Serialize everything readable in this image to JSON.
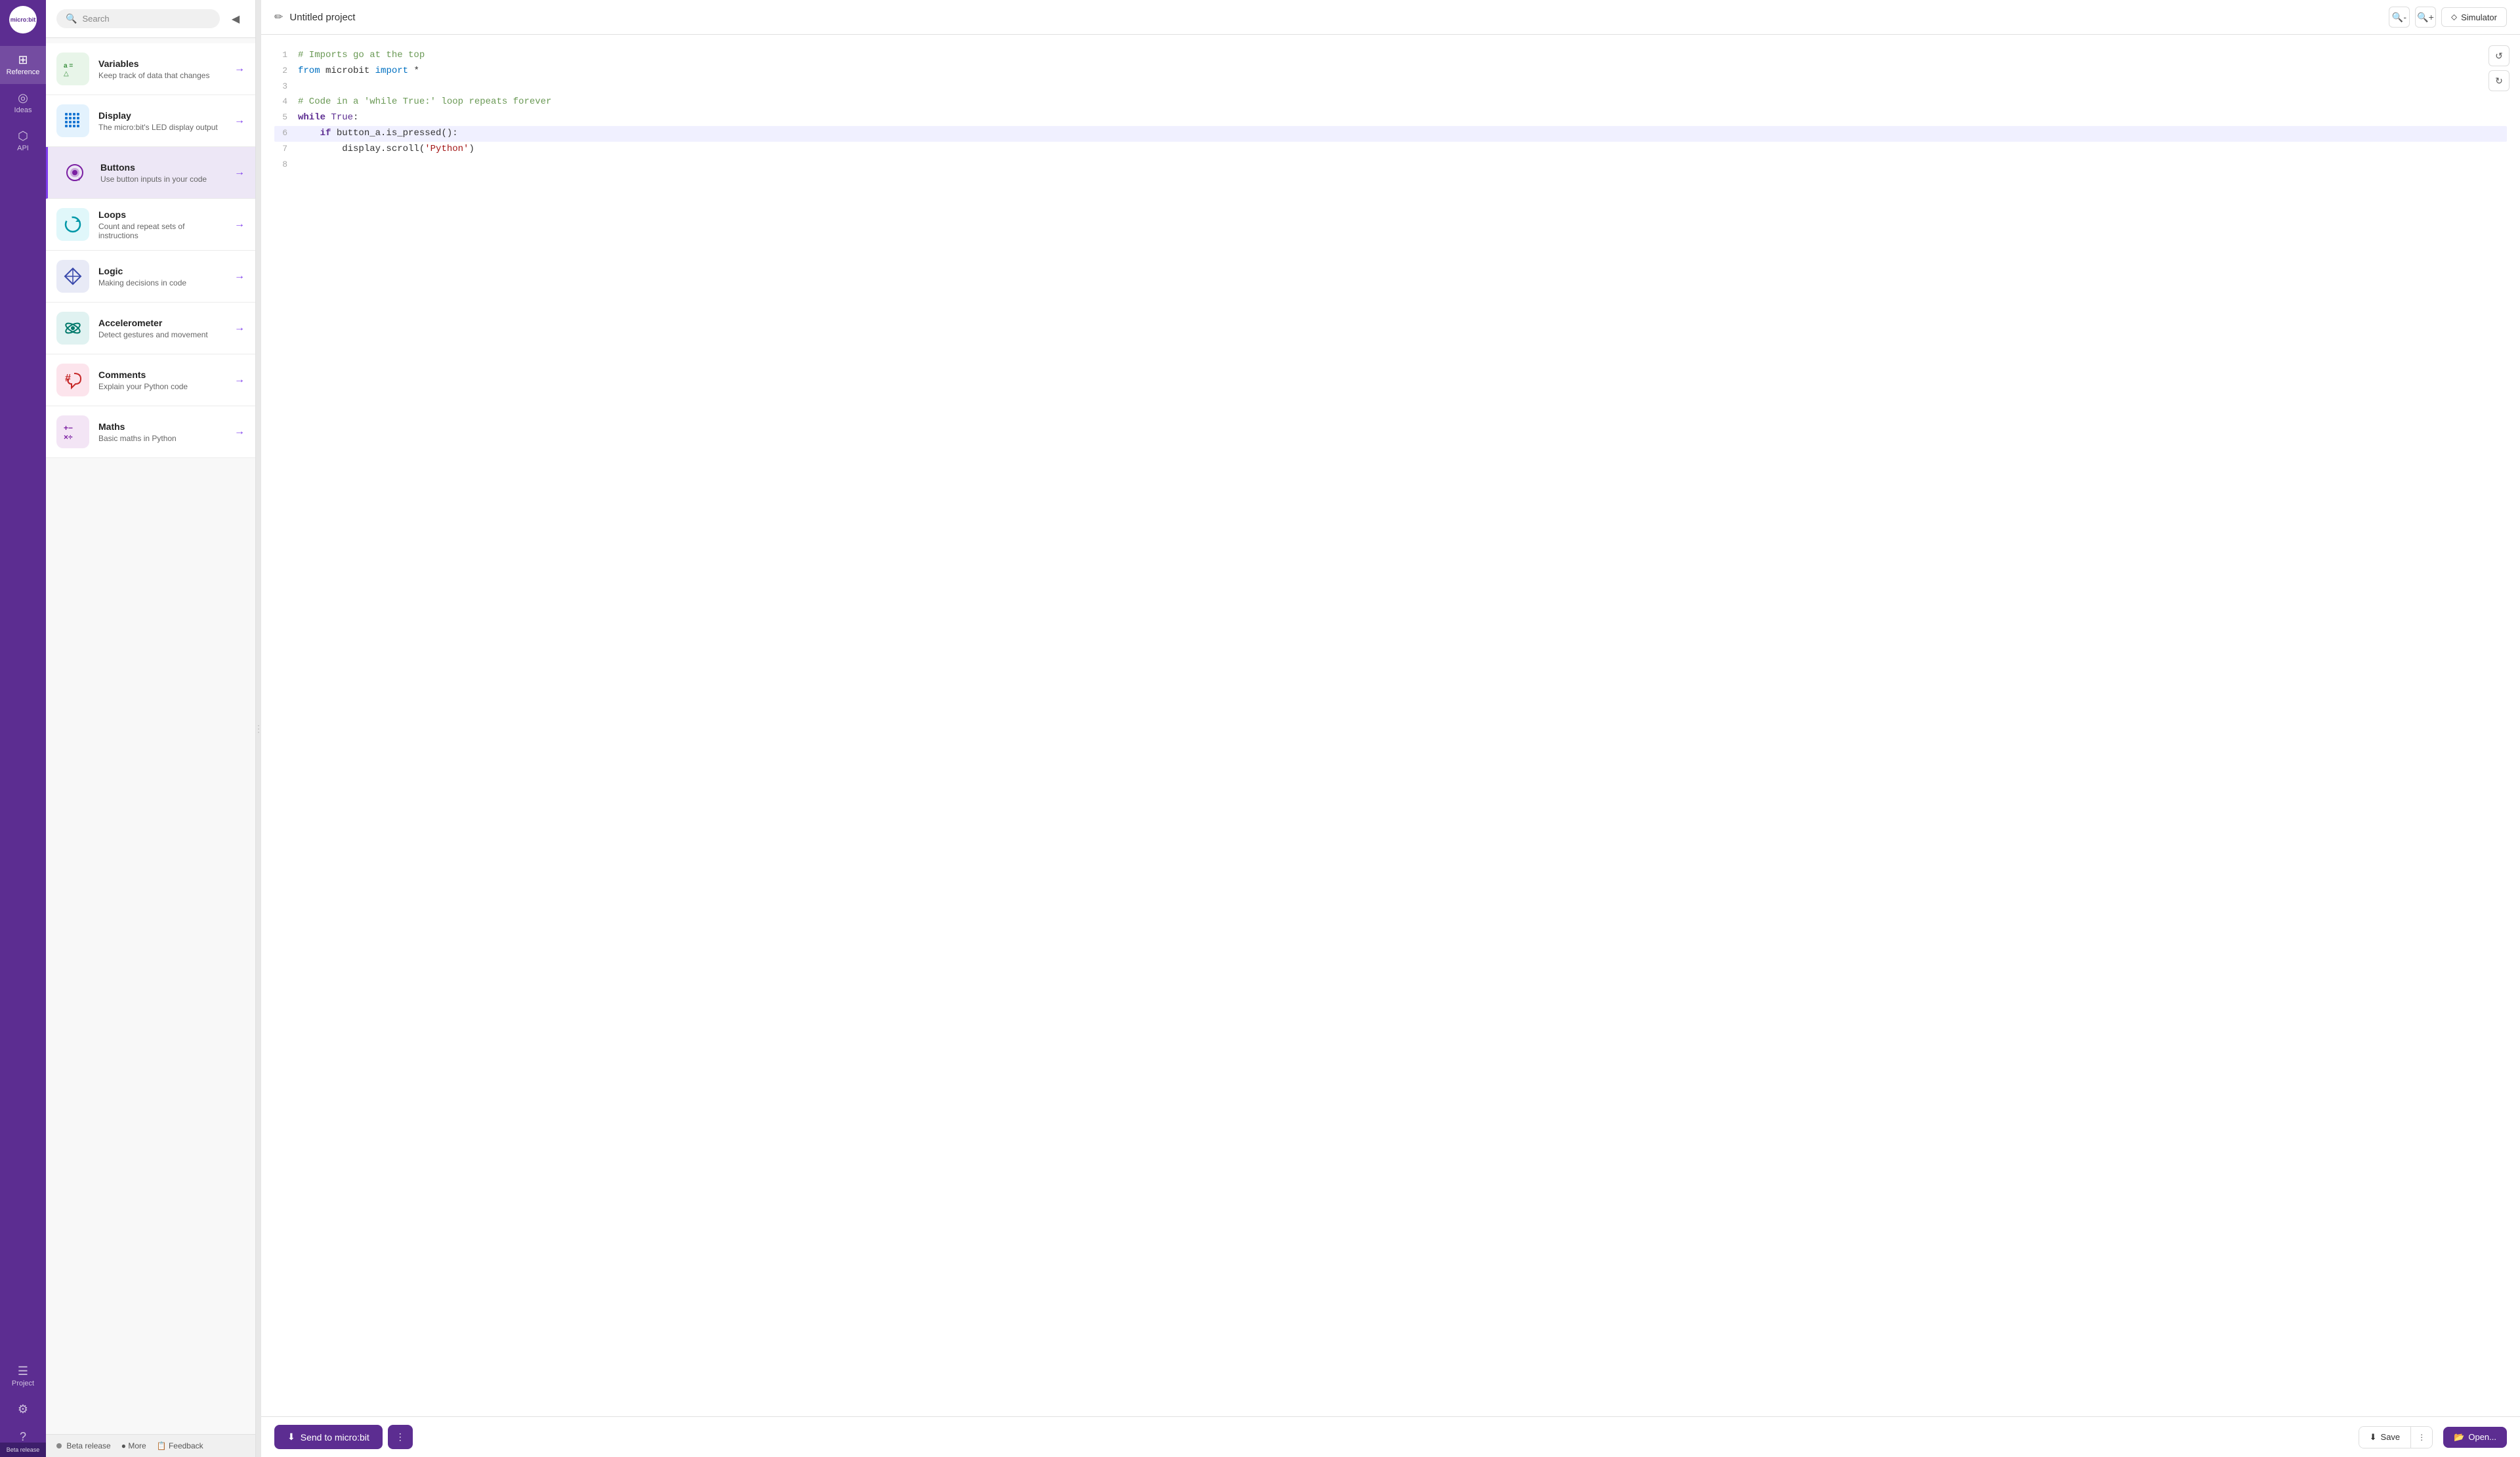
{
  "app": {
    "title": "micro:bit",
    "project_title": "Untitled project"
  },
  "nav": {
    "logo_text": "micro:bit",
    "items": [
      {
        "id": "reference",
        "label": "Reference",
        "icon": "⊞",
        "active": true
      },
      {
        "id": "ideas",
        "label": "Ideas",
        "icon": "💡"
      },
      {
        "id": "api",
        "label": "API",
        "icon": "⬡"
      },
      {
        "id": "project",
        "label": "Project",
        "icon": "📁"
      },
      {
        "id": "settings",
        "label": "",
        "icon": "⚙"
      },
      {
        "id": "help",
        "label": "",
        "icon": "?"
      }
    ]
  },
  "reference": {
    "search_placeholder": "Search",
    "items": [
      {
        "id": "variables",
        "title": "Variables",
        "desc": "Keep track of data that changes",
        "icon": "a=",
        "icon_class": "ref-icon-variables"
      },
      {
        "id": "display",
        "title": "Display",
        "desc": "The micro:bit's LED display output",
        "icon": "⠿",
        "icon_class": "ref-icon-display"
      },
      {
        "id": "buttons",
        "title": "Buttons",
        "desc": "Use button inputs in your code",
        "icon": "⊙",
        "icon_class": "ref-icon-buttons",
        "active": true
      },
      {
        "id": "loops",
        "title": "Loops",
        "desc": "Count and repeat sets of instructions",
        "icon": "↻",
        "icon_class": "ref-icon-loops"
      },
      {
        "id": "logic",
        "title": "Logic",
        "desc": "Making decisions in code",
        "icon": "◇",
        "icon_class": "ref-icon-logic"
      },
      {
        "id": "accelerometer",
        "title": "Accelerometer",
        "desc": "Detect gestures and movement",
        "icon": "⟳",
        "icon_class": "ref-icon-accelerometer"
      },
      {
        "id": "comments",
        "title": "Comments",
        "desc": "Explain your Python code",
        "icon": "#",
        "icon_class": "ref-icon-comments"
      },
      {
        "id": "maths",
        "title": "Maths",
        "desc": "Basic maths in Python",
        "icon": "+-",
        "icon_class": "ref-icon-maths"
      }
    ],
    "bottom": {
      "beta_label": "Beta release",
      "more_label": "More",
      "feedback_label": "Feedback"
    }
  },
  "editor": {
    "zoom_in_label": "+",
    "zoom_out_label": "−",
    "undo_label": "↺",
    "redo_label": "↻",
    "simulator_label": "Simulator",
    "lines": [
      {
        "num": 1,
        "content": "# Imports go at the top",
        "type": "comment"
      },
      {
        "num": 2,
        "content": "from microbit import *",
        "type": "import"
      },
      {
        "num": 3,
        "content": "",
        "type": "blank"
      },
      {
        "num": 4,
        "content": "# Code in a 'while True:' loop repeats forever",
        "type": "comment"
      },
      {
        "num": 5,
        "content": "while True:",
        "type": "keyword"
      },
      {
        "num": 6,
        "content": "    if button_a.is_pressed():",
        "type": "code"
      },
      {
        "num": 7,
        "content": "        display.scroll('Python')",
        "type": "code"
      },
      {
        "num": 8,
        "content": "",
        "type": "blank"
      }
    ]
  },
  "toolbar": {
    "send_label": "Send to micro:bit",
    "send_icon": "↓",
    "send_options_icon": "⋮",
    "save_icon": "↓",
    "save_label": "Save",
    "save_more_icon": "⋮",
    "open_icon": "📂",
    "open_label": "Open..."
  }
}
